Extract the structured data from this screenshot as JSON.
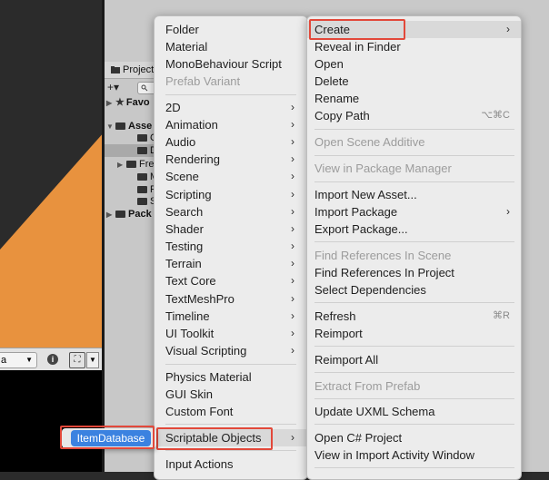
{
  "project_panel": {
    "tab_label": "Project",
    "add_label": "+▾",
    "tree": [
      {
        "label": "Favo",
        "bold": true,
        "fold": "▶",
        "icon": "star"
      },
      {
        "label": "Asse",
        "bold": true,
        "fold": "▼",
        "icon": "folder"
      },
      {
        "label": "C#",
        "bold": false,
        "fold": "",
        "icon": "folder"
      },
      {
        "label": "Da",
        "bold": false,
        "fold": "",
        "icon": "folder",
        "selected": true
      },
      {
        "label": "Fre",
        "bold": false,
        "fold": "▶",
        "icon": "folder"
      },
      {
        "label": "Ma",
        "bold": false,
        "fold": "",
        "icon": "folder"
      },
      {
        "label": "Pre",
        "bold": false,
        "fold": "",
        "icon": "folder"
      },
      {
        "label": "Sc",
        "bold": false,
        "fold": "",
        "icon": "folder"
      },
      {
        "label": "Pack",
        "bold": true,
        "fold": "▶",
        "icon": "folder"
      }
    ]
  },
  "inspector_bar": {
    "dropdown_text": "a",
    "info_icon": "i",
    "frame_icon": "⛶"
  },
  "left_menu": {
    "items": {
      "folder": "Folder",
      "material": "Material",
      "mono_script": "MonoBehaviour Script",
      "prefab_variant": "Prefab Variant",
      "item_2d": "2D",
      "animation": "Animation",
      "audio": "Audio",
      "rendering": "Rendering",
      "scene": "Scene",
      "scripting": "Scripting",
      "search": "Search",
      "shader": "Shader",
      "testing": "Testing",
      "terrain": "Terrain",
      "text_core": "Text Core",
      "textmeshpro": "TextMeshPro",
      "timeline": "Timeline",
      "ui_toolkit": "UI Toolkit",
      "visual_scripting": "Visual Scripting",
      "physics_material": "Physics Material",
      "gui_skin": "GUI Skin",
      "custom_font": "Custom Font",
      "scriptable_objects": "Scriptable Objects",
      "input_actions": "Input Actions"
    },
    "arrow": "›"
  },
  "right_menu": {
    "items": {
      "create": "Create",
      "reveal_in_finder": "Reveal in Finder",
      "open": "Open",
      "delete": "Delete",
      "rename": "Rename",
      "copy_path": "Copy Path",
      "open_scene_additive": "Open Scene Additive",
      "view_in_package_manager": "View in Package Manager",
      "import_new_asset": "Import New Asset...",
      "import_package": "Import Package",
      "export_package": "Export Package...",
      "find_refs_scene": "Find References In Scene",
      "find_refs_project": "Find References In Project",
      "select_dependencies": "Select Dependencies",
      "refresh": "Refresh",
      "reimport": "Reimport",
      "reimport_all": "Reimport All",
      "extract_from_prefab": "Extract From Prefab",
      "update_uxml_schema": "Update UXML Schema",
      "open_csharp_project": "Open C# Project",
      "view_in_import_activity": "View in Import Activity Window"
    },
    "shortcuts": {
      "copy_path": "⌥⌘C",
      "refresh": "⌘R"
    },
    "arrow": "›"
  },
  "submenu": {
    "item_database": "ItemDatabase"
  },
  "colors": {
    "orange": "#e8923e",
    "highlight_red": "#e2483a",
    "selection_blue": "#3b82e0",
    "menu_bg": "#ececec"
  }
}
